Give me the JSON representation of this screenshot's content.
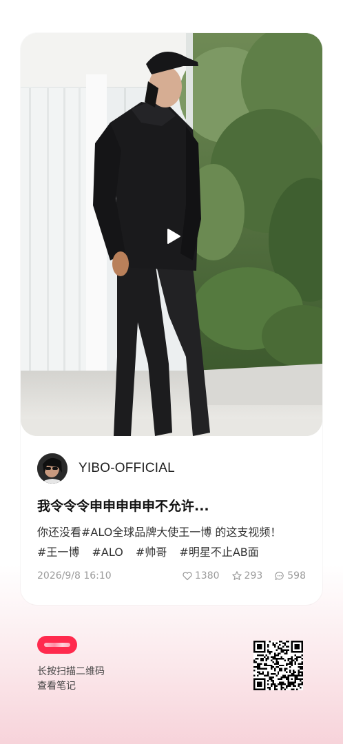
{
  "post": {
    "video_state": "paused",
    "author": "YIBO-OFFICIAL",
    "title": "我令令令申申申申申不允许...",
    "body_text": "你还没看#ALO全球品牌大使王一博  的这支视频！",
    "tags": [
      "#王一博",
      "#ALO",
      "#帅哥",
      "#明星不止AB面"
    ],
    "date": "2026/9/8 16:10",
    "likes": "1380",
    "favorites": "293",
    "comments": "598"
  },
  "footer": {
    "line1": "长按扫描二维码",
    "line2": "查看笔记"
  },
  "colors": {
    "brand_red": "#ff2a4d",
    "meta_gray": "#9a9a9a",
    "background_pink": "#f7d3da"
  },
  "icons": [
    "play-icon",
    "heart-icon",
    "star-icon",
    "comment-icon",
    "qr-code"
  ]
}
